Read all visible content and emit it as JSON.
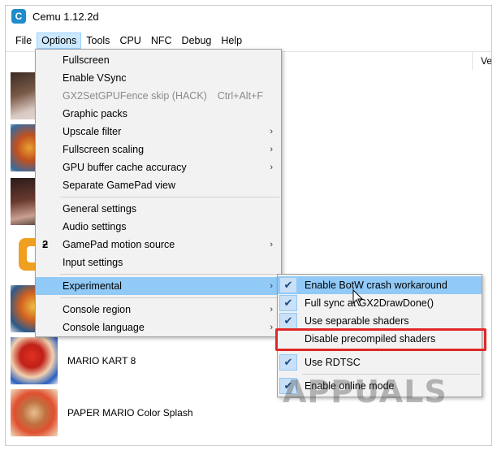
{
  "window": {
    "title": "Cemu 1.12.2d",
    "app_icon": "C"
  },
  "menubar": {
    "items": [
      "File",
      "Options",
      "Tools",
      "CPU",
      "NFC",
      "Debug",
      "Help"
    ],
    "active": "Options"
  },
  "list": {
    "column_header": "Ve",
    "games": [
      {
        "title": ""
      },
      {
        "title": ""
      },
      {
        "title": ""
      },
      {
        "title": ""
      },
      {
        "title": ""
      },
      {
        "title": "MARIO KART 8"
      },
      {
        "title": "PAPER MARIO Color Splash"
      }
    ]
  },
  "options_menu": {
    "items": [
      {
        "label": "Fullscreen"
      },
      {
        "label": "Enable VSync"
      },
      {
        "label": "GX2SetGPUFence skip (HACK)",
        "shortcut": "Ctrl+Alt+F"
      },
      {
        "label": "Graphic packs"
      },
      {
        "label": "Upscale filter",
        "arrow": "›"
      },
      {
        "label": "Fullscreen scaling",
        "arrow": "›"
      },
      {
        "label": "GPU buffer cache accuracy",
        "arrow": "›"
      },
      {
        "label": "Separate GamePad view"
      },
      {
        "label": "General settings"
      },
      {
        "label": "Audio settings"
      },
      {
        "label": "GamePad motion source",
        "arrow": "›"
      },
      {
        "label": "Input settings"
      },
      {
        "label": "Experimental",
        "arrow": "›"
      },
      {
        "label": "Console region",
        "arrow": "›"
      },
      {
        "label": "Console language",
        "arrow": "›"
      }
    ],
    "gamepad_icon": "ƻ"
  },
  "experimental_menu": {
    "check_glyph": "✔",
    "items": [
      {
        "label": "Enable BotW crash workaround",
        "checked": true
      },
      {
        "label": "Full sync at GX2DrawDone()",
        "checked": true
      },
      {
        "label": "Use separable shaders",
        "checked": true
      },
      {
        "label": "Disable precompiled shaders",
        "checked": false
      },
      {
        "label": "Use RDTSC",
        "checked": true
      },
      {
        "label": "Enable online mode",
        "checked": true
      }
    ]
  },
  "watermark": "APPUALS",
  "colors": {
    "menu_highlight": "#91c9f7",
    "callout_red": "#e02828",
    "app_icon_blue": "#1f8ccb"
  }
}
